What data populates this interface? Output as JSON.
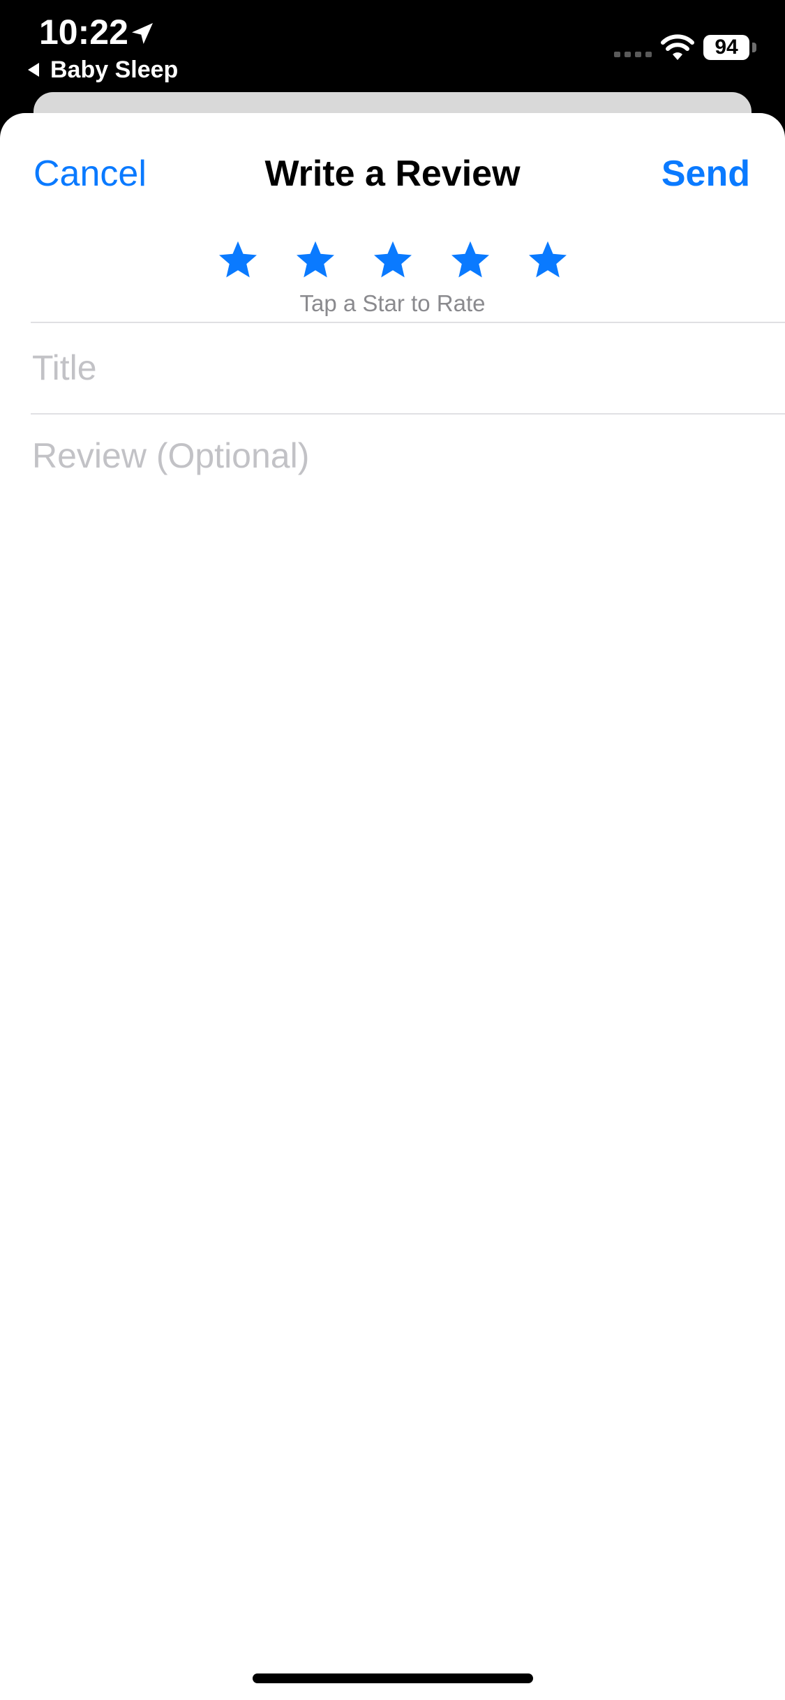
{
  "status_bar": {
    "time": "10:22",
    "back_app_label": "Baby Sleep",
    "battery_level": "94",
    "icons": [
      "location-arrow-icon",
      "cellular-signal-icon",
      "wifi-icon",
      "battery-icon"
    ]
  },
  "nav": {
    "cancel_label": "Cancel",
    "title": "Write a Review",
    "send_label": "Send"
  },
  "rating": {
    "star_count": 5,
    "hint": "Tap a Star to Rate"
  },
  "form": {
    "title_placeholder": "Title",
    "review_placeholder": "Review (Optional)"
  },
  "colors": {
    "accent": "#0a7aff",
    "placeholder": "#c2c2c6",
    "hint": "#8a8a8e"
  }
}
